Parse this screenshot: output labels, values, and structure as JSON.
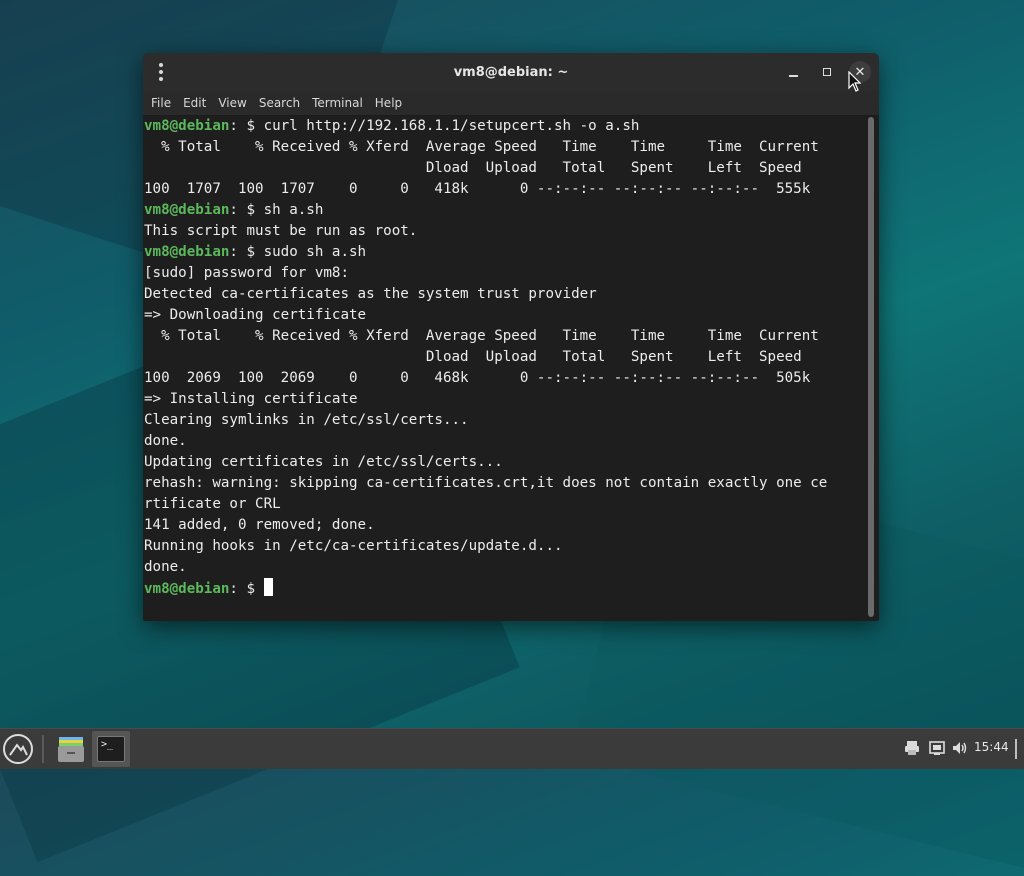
{
  "window": {
    "title": "vm8@debian: ~",
    "menu": [
      "File",
      "Edit",
      "View",
      "Search",
      "Terminal",
      "Help"
    ]
  },
  "colors": {
    "prompt_user_host": "#5cb85c",
    "terminal_bg": "#1e1e1e",
    "terminal_fg": "#ececec"
  },
  "terminal": {
    "prompt_user": "vm8@debian",
    "prompt_rest": ": $ ",
    "lines": [
      {
        "prompt": true,
        "text": "curl http://192.168.1.1/setupcert.sh -o a.sh"
      },
      {
        "prompt": false,
        "text": "  % Total    % Received % Xferd  Average Speed   Time    Time     Time  Current"
      },
      {
        "prompt": false,
        "text": "                                 Dload  Upload   Total   Spent    Left  Speed"
      },
      {
        "prompt": false,
        "text": "100  1707  100  1707    0     0   418k      0 --:--:-- --:--:-- --:--:--  555k"
      },
      {
        "prompt": true,
        "text": "sh a.sh"
      },
      {
        "prompt": false,
        "text": "This script must be run as root."
      },
      {
        "prompt": true,
        "text": "sudo sh a.sh"
      },
      {
        "prompt": false,
        "text": "[sudo] password for vm8:"
      },
      {
        "prompt": false,
        "text": "Detected ca-certificates as the system trust provider"
      },
      {
        "prompt": false,
        "text": "=> Downloading certificate"
      },
      {
        "prompt": false,
        "text": "  % Total    % Received % Xferd  Average Speed   Time    Time     Time  Current"
      },
      {
        "prompt": false,
        "text": "                                 Dload  Upload   Total   Spent    Left  Speed"
      },
      {
        "prompt": false,
        "text": "100  2069  100  2069    0     0   468k      0 --:--:-- --:--:-- --:--:--  505k"
      },
      {
        "prompt": false,
        "text": "=> Installing certificate"
      },
      {
        "prompt": false,
        "text": "Clearing symlinks in /etc/ssl/certs..."
      },
      {
        "prompt": false,
        "text": "done."
      },
      {
        "prompt": false,
        "text": "Updating certificates in /etc/ssl/certs..."
      },
      {
        "prompt": false,
        "text": "rehash: warning: skipping ca-certificates.crt,it does not contain exactly one ce"
      },
      {
        "prompt": false,
        "text": "rtificate or CRL"
      },
      {
        "prompt": false,
        "text": "141 added, 0 removed; done."
      },
      {
        "prompt": false,
        "text": "Running hooks in /etc/ca-certificates/update.d..."
      },
      {
        "prompt": false,
        "text": "done."
      },
      {
        "prompt": true,
        "text": "",
        "cursor": true
      }
    ]
  },
  "taskbar": {
    "clock": "15:44",
    "apps": [
      "files-icon",
      "terminal-icon"
    ],
    "tray_icons": [
      "printer-icon",
      "network-icon",
      "volume-icon"
    ]
  }
}
